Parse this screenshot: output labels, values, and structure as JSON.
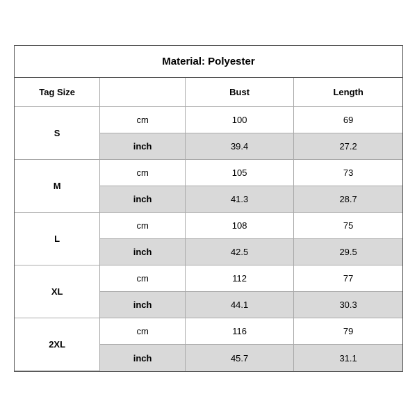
{
  "title": "Material: Polyester",
  "headers": {
    "tag_size": "Tag Size",
    "bust": "Bust",
    "length": "Length"
  },
  "sizes": [
    {
      "tag": "S",
      "cm": {
        "bust": "100",
        "length": "69"
      },
      "inch": {
        "bust": "39.4",
        "length": "27.2"
      }
    },
    {
      "tag": "M",
      "cm": {
        "bust": "105",
        "length": "73"
      },
      "inch": {
        "bust": "41.3",
        "length": "28.7"
      }
    },
    {
      "tag": "L",
      "cm": {
        "bust": "108",
        "length": "75"
      },
      "inch": {
        "bust": "42.5",
        "length": "29.5"
      }
    },
    {
      "tag": "XL",
      "cm": {
        "bust": "112",
        "length": "77"
      },
      "inch": {
        "bust": "44.1",
        "length": "30.3"
      }
    },
    {
      "tag": "2XL",
      "cm": {
        "bust": "116",
        "length": "79"
      },
      "inch": {
        "bust": "45.7",
        "length": "31.1"
      }
    }
  ],
  "unit_cm": "cm",
  "unit_inch": "inch"
}
